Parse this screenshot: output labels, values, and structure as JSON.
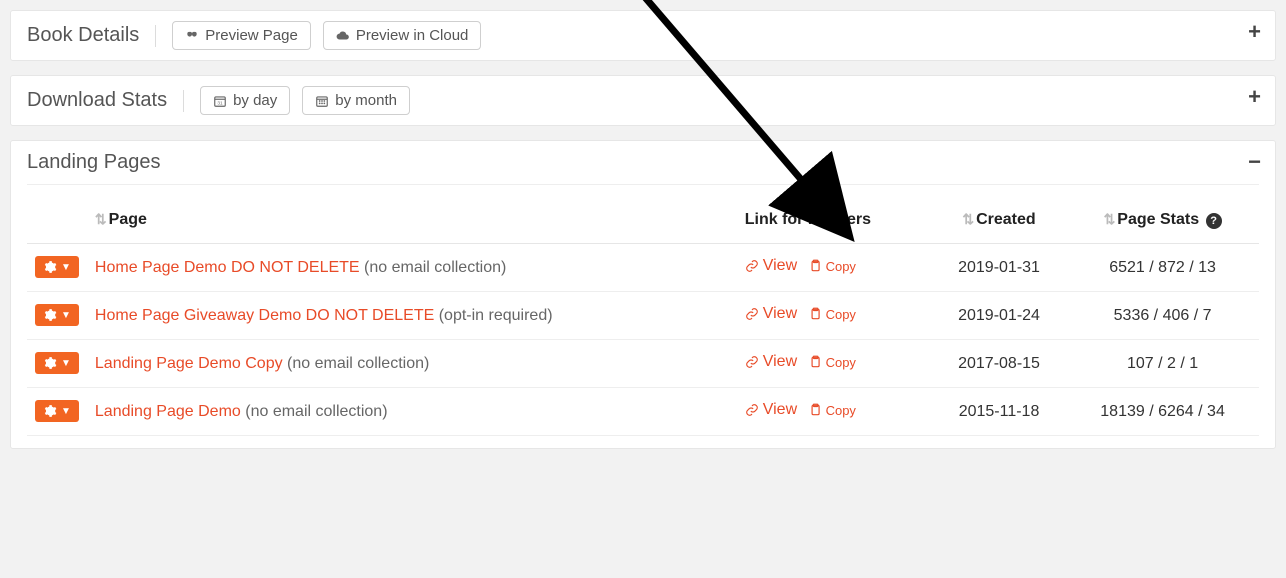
{
  "panels": {
    "book_details": {
      "title": "Book Details",
      "preview_page": "Preview Page",
      "preview_cloud": "Preview in Cloud",
      "toggle": "+"
    },
    "download_stats": {
      "title": "Download Stats",
      "by_day": "by day",
      "by_month": "by month",
      "toggle": "+"
    },
    "landing_pages": {
      "title": "Landing Pages",
      "toggle": "−",
      "columns": {
        "page": "Page",
        "link": "Link for Readers",
        "created": "Created",
        "stats": "Page Stats"
      },
      "view_label": "View",
      "copy_label": "Copy",
      "rows": [
        {
          "name": "Home Page Demo DO NOT DELETE",
          "note": "(no email collection)",
          "created": "2019-01-31",
          "stats": "6521 / 872 / 13"
        },
        {
          "name": "Home Page Giveaway Demo DO NOT DELETE",
          "note": "(opt-in required)",
          "created": "2019-01-24",
          "stats": "5336 / 406 / 7"
        },
        {
          "name": "Landing Page Demo Copy",
          "note": "(no email collection)",
          "created": "2017-08-15",
          "stats": "107 / 2 / 1"
        },
        {
          "name": "Landing Page Demo",
          "note": "(no email collection)",
          "created": "2015-11-18",
          "stats": "18139 / 6264 / 34"
        }
      ]
    }
  }
}
